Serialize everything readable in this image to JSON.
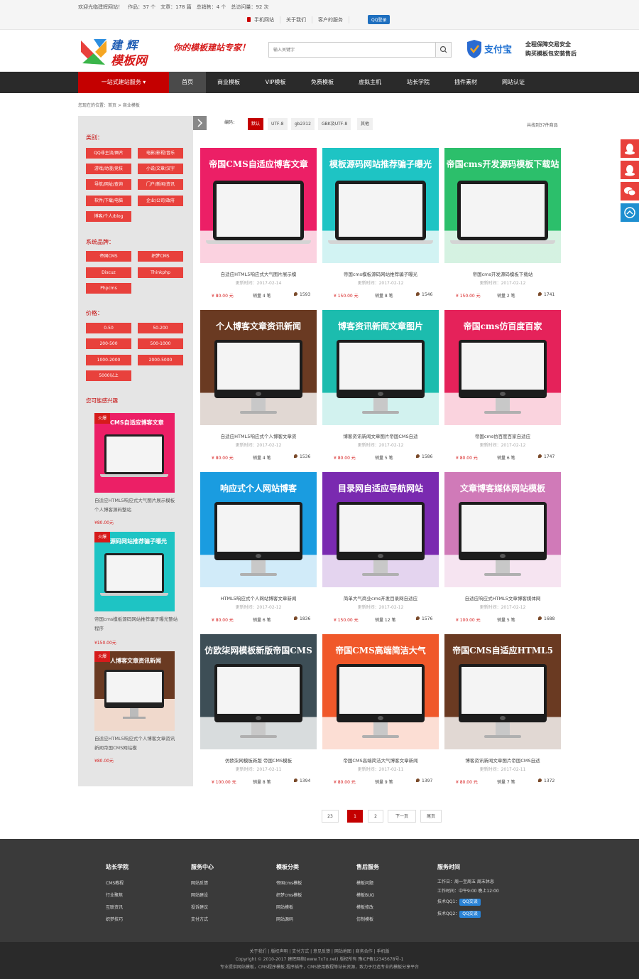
{
  "topbar": {
    "welcome": "欢迎光临建辉网站！　作品：37 个　文章：178 篇　总销售：4 个　总访问量：92 次",
    "links": [
      "手机网站",
      "关于我们",
      "客户的服务"
    ],
    "qq_login": "QQ登录"
  },
  "header": {
    "logo_text_1": "建 辉",
    "logo_text_2": "模板网",
    "slogan": "你的模板建站专家！",
    "search_placeholder": "输入关键字",
    "alipay_label": "支付宝",
    "trust_line1": "全程保障交易安全",
    "trust_line2": "购买模板包安装售后"
  },
  "nav": {
    "all_services": "一站式建站服务 ▾",
    "items": [
      "首页",
      "商业模板",
      "VIP模板",
      "免费模板",
      "虚拟主机",
      "站长学院",
      "插件素材",
      "网站认证"
    ]
  },
  "breadcrumb": "您现在的位置：首页 > 商业模板",
  "sidebar": {
    "category_title": "类别：",
    "categories": [
      "QQ非主流/图片",
      "电影/影视/音乐",
      "游戏/动漫/竞技",
      "小说/文章/汉字",
      "导航/网址/查询",
      "门户/新闻/资讯",
      "软件/下载/电脑",
      "企业/公司/政府",
      "博客/个人/blog"
    ],
    "system_title": "系统品牌：",
    "systems": [
      "帝国CMS",
      "织梦CMS",
      "Discuz",
      "Thinkphp",
      "Phpcms"
    ],
    "price_title": "价格：",
    "prices": [
      "0-50",
      "50-200",
      "200-500",
      "500-1000",
      "1000-2000",
      "2000-5000",
      "5000以上"
    ],
    "interest_title": "您可能感兴趣",
    "hot_label": "火爆",
    "recommendations": [
      {
        "banner": "CMS自适应博客文章",
        "title": "自适应HTML5响应式大气图片展示模板个人博客源码整站",
        "price": "¥80.00元"
      },
      {
        "banner": "源码网站推荐骗子曝光",
        "title": "帝国cms模板源码网站推荐骗子曝光整站程序",
        "price": "¥150.00元"
      },
      {
        "banner": "人博客文章资讯新闻",
        "title": "自适应HTML5响应式个人博客文章资讯新闻帝国CMS网站模",
        "price": "¥80.00元"
      }
    ]
  },
  "filter": {
    "label": "编码：",
    "options": [
      "默认",
      "UTF-8",
      "gb2312",
      "GBK及UTF-8",
      "其他"
    ],
    "count": "共找到37件商品"
  },
  "products": [
    {
      "banner": "帝国CMS自适应博客文章",
      "title": "自适应HTML5响应式大气图片展示模",
      "date": "更新时间：2017-02-14",
      "price": "¥ 80.00 元",
      "sales": "销量 4 笔",
      "views": "1593",
      "bg": "#ec1f66"
    },
    {
      "banner": "模板源码网站推荐骗子曝光",
      "title": "帝国cms模板源码网站推荐骗子曝光",
      "date": "更新时间：2017-02-12",
      "price": "¥ 150.00 元",
      "sales": "销量 8 笔",
      "views": "1546",
      "bg": "#1ec4c4"
    },
    {
      "banner": "帝国cms开发源码模板下载站",
      "title": "帝国cms开发源码模板下载站",
      "date": "更新时间：2017-02-12",
      "price": "¥ 150.00 元",
      "sales": "销量 2 笔",
      "views": "1741",
      "bg": "#2cbf6b"
    },
    {
      "banner": "个人博客文章资讯新闻",
      "title": "自适应HTML5响应式个人博客文章资",
      "date": "更新时间：2017-02-12",
      "price": "¥ 80.00 元",
      "sales": "销量 4 笔",
      "views": "1536",
      "bg": "#6a3a22"
    },
    {
      "banner": "博客资讯新闻文章图片",
      "title": "博客资讯新闻文章图片帝国CMS自适",
      "date": "更新时间：2017-02-12",
      "price": "¥ 80.00 元",
      "sales": "销量 5 笔",
      "views": "1586",
      "bg": "#1cbcae"
    },
    {
      "banner": "帝国cms仿百度百家",
      "title": "帝国cms仿百度百家自适应",
      "date": "更新时间：2017-02-12",
      "price": "¥ 80.00 元",
      "sales": "销量 6 笔",
      "views": "1747",
      "bg": "#e5225a"
    },
    {
      "banner": "响应式个人网站博客",
      "title": "HTML5响应式个人网站博客文章新闻",
      "date": "更新时间：2017-02-12",
      "price": "¥ 80.00 元",
      "sales": "销量 6 笔",
      "views": "1836",
      "bg": "#1a9ce0"
    },
    {
      "banner": "目录网自适应导航网站",
      "title": "简单大气商业cms开发目录网自适应",
      "date": "更新时间：2017-02-12",
      "price": "¥ 150.00 元",
      "sales": "销量 12 笔",
      "views": "1576",
      "bg": "#7a2ab0"
    },
    {
      "banner": "文章博客媒体网站模板",
      "title": "自适应响应式HTML5文章博客媒体网",
      "date": "更新时间：2017-02-12",
      "price": "¥ 100.00 元",
      "sales": "销量 5 笔",
      "views": "1688",
      "bg": "#d07ab8"
    },
    {
      "banner": "仿欧柒网模板新版帝国CMS",
      "title": "仿欧柒网模板新版 帝国CMS模板",
      "date": "更新时间：2017-02-11",
      "price": "¥ 100.00 元",
      "sales": "销量 8 笔",
      "views": "1394",
      "bg": "#3d4e56"
    },
    {
      "banner": "帝国CMS高端简洁大气",
      "title": "帝国CMS高端简洁大气博客文章新闻",
      "date": "更新时间：2017-02-11",
      "price": "¥ 80.00 元",
      "sales": "销量 9 笔",
      "views": "1397",
      "bg": "#f0582a"
    },
    {
      "banner": "帝国CMS自适应HTML5",
      "title": "博客资讯新闻文章图片帝国CMS自适",
      "date": "更新时间：2017-02-11",
      "price": "¥ 80.00 元",
      "sales": "销量 7 笔",
      "views": "1372",
      "bg": "#6a3a22"
    }
  ],
  "pagination": {
    "total": "23",
    "current": "1",
    "next_page": "2",
    "next": "下一页",
    "last": "尾页"
  },
  "footer": {
    "cols": [
      {
        "title": "站长学院",
        "items": [
          "CMS教程",
          "行业聚焦",
          "互联资讯",
          "织梦技巧"
        ]
      },
      {
        "title": "服务中心",
        "items": [
          "网站反馈",
          "网站建设",
          "投诉建议",
          "支付方式"
        ]
      },
      {
        "title": "模板分类",
        "items": [
          "帝国cms模板",
          "织梦cms模板",
          "网站模板",
          "网站源码"
        ]
      },
      {
        "title": "售后服务",
        "items": [
          "模板问题",
          "模板BUG",
          "模板修改",
          "仿制模板"
        ]
      }
    ],
    "service_title": "服务时间",
    "hours1": "工作日：周一至周五 周末休息",
    "hours2": "工作时间：中午9:00  晚上12:00",
    "qq1_label": "技术QQ1：",
    "qq2_label": "技术QQ2：",
    "qq_btn": "QQ交谈",
    "bottom_links": "关于我们 | 版权声明 | 支付方式 | 意见反馈 | 网站地图 | 商务合作 | 手机版",
    "copyright": "Copyright © 2010-2017 建辉网络(www.7x7x.net) 版权所有 豫ICP备12345678号-1",
    "desc": "专业提供网站模板，CMS程序模板,程序插件，CMS使用教程等站长资源，致力于打造专业的模板分享平台"
  }
}
